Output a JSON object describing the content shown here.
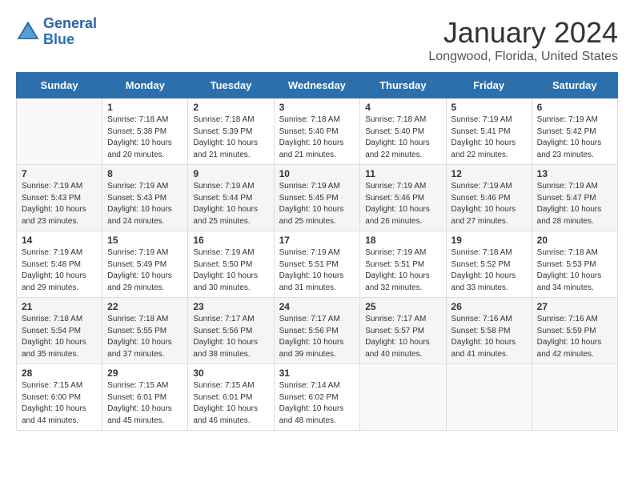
{
  "header": {
    "logo_line1": "General",
    "logo_line2": "Blue",
    "month": "January 2024",
    "location": "Longwood, Florida, United States"
  },
  "weekdays": [
    "Sunday",
    "Monday",
    "Tuesday",
    "Wednesday",
    "Thursday",
    "Friday",
    "Saturday"
  ],
  "weeks": [
    [
      {
        "day": "",
        "sunrise": "",
        "sunset": "",
        "daylight": ""
      },
      {
        "day": "1",
        "sunrise": "Sunrise: 7:18 AM",
        "sunset": "Sunset: 5:38 PM",
        "daylight": "Daylight: 10 hours and 20 minutes."
      },
      {
        "day": "2",
        "sunrise": "Sunrise: 7:18 AM",
        "sunset": "Sunset: 5:39 PM",
        "daylight": "Daylight: 10 hours and 21 minutes."
      },
      {
        "day": "3",
        "sunrise": "Sunrise: 7:18 AM",
        "sunset": "Sunset: 5:40 PM",
        "daylight": "Daylight: 10 hours and 21 minutes."
      },
      {
        "day": "4",
        "sunrise": "Sunrise: 7:18 AM",
        "sunset": "Sunset: 5:40 PM",
        "daylight": "Daylight: 10 hours and 22 minutes."
      },
      {
        "day": "5",
        "sunrise": "Sunrise: 7:19 AM",
        "sunset": "Sunset: 5:41 PM",
        "daylight": "Daylight: 10 hours and 22 minutes."
      },
      {
        "day": "6",
        "sunrise": "Sunrise: 7:19 AM",
        "sunset": "Sunset: 5:42 PM",
        "daylight": "Daylight: 10 hours and 23 minutes."
      }
    ],
    [
      {
        "day": "7",
        "sunrise": "Sunrise: 7:19 AM",
        "sunset": "Sunset: 5:43 PM",
        "daylight": "Daylight: 10 hours and 23 minutes."
      },
      {
        "day": "8",
        "sunrise": "Sunrise: 7:19 AM",
        "sunset": "Sunset: 5:43 PM",
        "daylight": "Daylight: 10 hours and 24 minutes."
      },
      {
        "day": "9",
        "sunrise": "Sunrise: 7:19 AM",
        "sunset": "Sunset: 5:44 PM",
        "daylight": "Daylight: 10 hours and 25 minutes."
      },
      {
        "day": "10",
        "sunrise": "Sunrise: 7:19 AM",
        "sunset": "Sunset: 5:45 PM",
        "daylight": "Daylight: 10 hours and 25 minutes."
      },
      {
        "day": "11",
        "sunrise": "Sunrise: 7:19 AM",
        "sunset": "Sunset: 5:46 PM",
        "daylight": "Daylight: 10 hours and 26 minutes."
      },
      {
        "day": "12",
        "sunrise": "Sunrise: 7:19 AM",
        "sunset": "Sunset: 5:46 PM",
        "daylight": "Daylight: 10 hours and 27 minutes."
      },
      {
        "day": "13",
        "sunrise": "Sunrise: 7:19 AM",
        "sunset": "Sunset: 5:47 PM",
        "daylight": "Daylight: 10 hours and 28 minutes."
      }
    ],
    [
      {
        "day": "14",
        "sunrise": "Sunrise: 7:19 AM",
        "sunset": "Sunset: 5:48 PM",
        "daylight": "Daylight: 10 hours and 29 minutes."
      },
      {
        "day": "15",
        "sunrise": "Sunrise: 7:19 AM",
        "sunset": "Sunset: 5:49 PM",
        "daylight": "Daylight: 10 hours and 29 minutes."
      },
      {
        "day": "16",
        "sunrise": "Sunrise: 7:19 AM",
        "sunset": "Sunset: 5:50 PM",
        "daylight": "Daylight: 10 hours and 30 minutes."
      },
      {
        "day": "17",
        "sunrise": "Sunrise: 7:19 AM",
        "sunset": "Sunset: 5:51 PM",
        "daylight": "Daylight: 10 hours and 31 minutes."
      },
      {
        "day": "18",
        "sunrise": "Sunrise: 7:19 AM",
        "sunset": "Sunset: 5:51 PM",
        "daylight": "Daylight: 10 hours and 32 minutes."
      },
      {
        "day": "19",
        "sunrise": "Sunrise: 7:18 AM",
        "sunset": "Sunset: 5:52 PM",
        "daylight": "Daylight: 10 hours and 33 minutes."
      },
      {
        "day": "20",
        "sunrise": "Sunrise: 7:18 AM",
        "sunset": "Sunset: 5:53 PM",
        "daylight": "Daylight: 10 hours and 34 minutes."
      }
    ],
    [
      {
        "day": "21",
        "sunrise": "Sunrise: 7:18 AM",
        "sunset": "Sunset: 5:54 PM",
        "daylight": "Daylight: 10 hours and 35 minutes."
      },
      {
        "day": "22",
        "sunrise": "Sunrise: 7:18 AM",
        "sunset": "Sunset: 5:55 PM",
        "daylight": "Daylight: 10 hours and 37 minutes."
      },
      {
        "day": "23",
        "sunrise": "Sunrise: 7:17 AM",
        "sunset": "Sunset: 5:56 PM",
        "daylight": "Daylight: 10 hours and 38 minutes."
      },
      {
        "day": "24",
        "sunrise": "Sunrise: 7:17 AM",
        "sunset": "Sunset: 5:56 PM",
        "daylight": "Daylight: 10 hours and 39 minutes."
      },
      {
        "day": "25",
        "sunrise": "Sunrise: 7:17 AM",
        "sunset": "Sunset: 5:57 PM",
        "daylight": "Daylight: 10 hours and 40 minutes."
      },
      {
        "day": "26",
        "sunrise": "Sunrise: 7:16 AM",
        "sunset": "Sunset: 5:58 PM",
        "daylight": "Daylight: 10 hours and 41 minutes."
      },
      {
        "day": "27",
        "sunrise": "Sunrise: 7:16 AM",
        "sunset": "Sunset: 5:59 PM",
        "daylight": "Daylight: 10 hours and 42 minutes."
      }
    ],
    [
      {
        "day": "28",
        "sunrise": "Sunrise: 7:15 AM",
        "sunset": "Sunset: 6:00 PM",
        "daylight": "Daylight: 10 hours and 44 minutes."
      },
      {
        "day": "29",
        "sunrise": "Sunrise: 7:15 AM",
        "sunset": "Sunset: 6:01 PM",
        "daylight": "Daylight: 10 hours and 45 minutes."
      },
      {
        "day": "30",
        "sunrise": "Sunrise: 7:15 AM",
        "sunset": "Sunset: 6:01 PM",
        "daylight": "Daylight: 10 hours and 46 minutes."
      },
      {
        "day": "31",
        "sunrise": "Sunrise: 7:14 AM",
        "sunset": "Sunset: 6:02 PM",
        "daylight": "Daylight: 10 hours and 48 minutes."
      },
      {
        "day": "",
        "sunrise": "",
        "sunset": "",
        "daylight": ""
      },
      {
        "day": "",
        "sunrise": "",
        "sunset": "",
        "daylight": ""
      },
      {
        "day": "",
        "sunrise": "",
        "sunset": "",
        "daylight": ""
      }
    ]
  ]
}
